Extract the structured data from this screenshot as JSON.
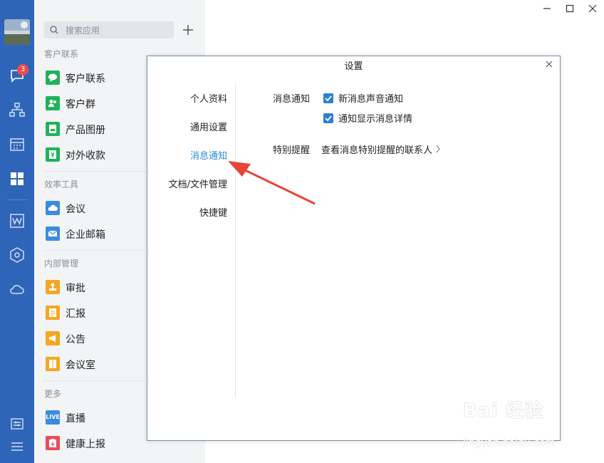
{
  "rail": {
    "badge_count": "3"
  },
  "search": {
    "placeholder": "搜索应用"
  },
  "sections": [
    {
      "title": "客户联系",
      "apps": [
        "客户联系",
        "客户群",
        "产品图册",
        "对外收款"
      ]
    },
    {
      "title": "效率工具",
      "apps": [
        "会议",
        "企业邮箱"
      ]
    },
    {
      "title": "内部管理",
      "apps": [
        "审批",
        "汇报",
        "公告",
        "会议室"
      ]
    },
    {
      "title": "更多",
      "apps": [
        "直播",
        "健康上报"
      ]
    }
  ],
  "live_icon_text": "LIVE",
  "dialog": {
    "title": "设置",
    "nav": [
      "个人资料",
      "通用设置",
      "消息通知",
      "文档/文件管理",
      "快捷键"
    ],
    "active_nav": "消息通知",
    "notify_label": "消息通知",
    "options": [
      "新消息声音通知",
      "通知显示消息详情"
    ],
    "special_label": "特别提醒",
    "special_link": "查看消息特别提醒的联系人"
  },
  "watermark": {
    "brand": "Bai 经验",
    "url": "jingyan.baidu.com"
  },
  "colors": {
    "rail": "#2f65b8",
    "accent": "#2b8ad8",
    "arrow": "#e8443a"
  }
}
